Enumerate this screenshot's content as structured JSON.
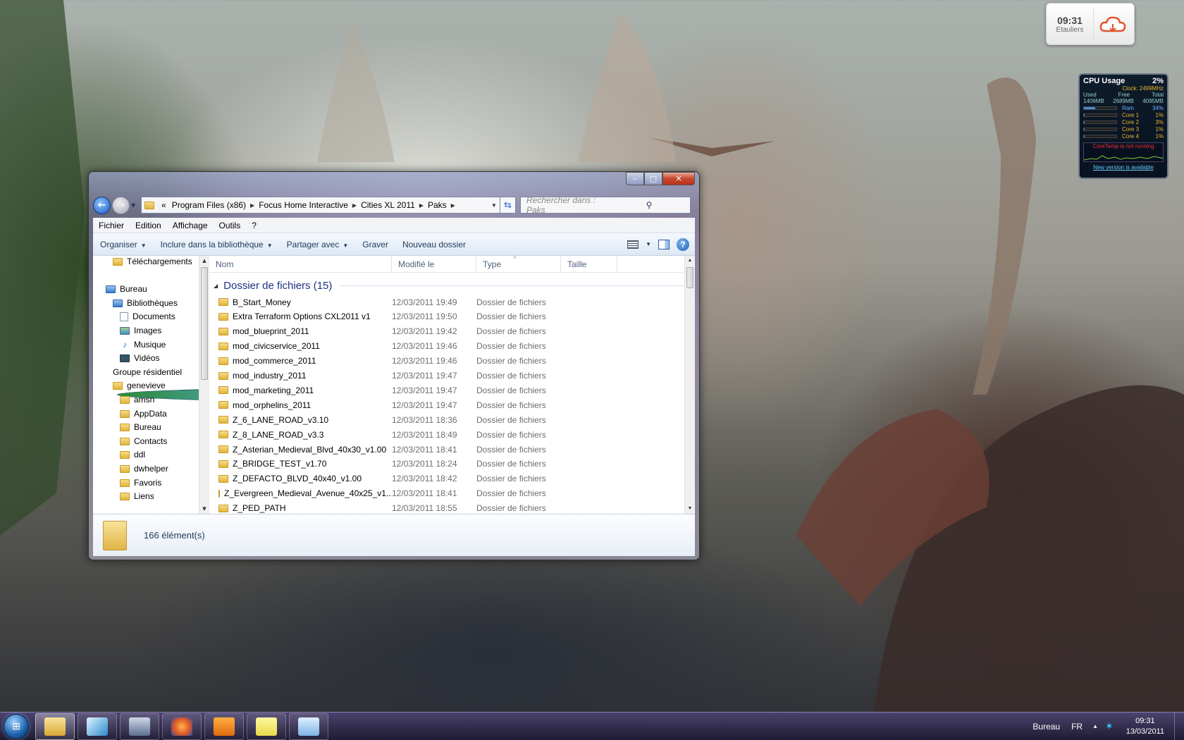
{
  "desktop": {
    "clock_gadget": {
      "time": "09:31",
      "city": "Etauliers"
    },
    "cpu_gadget": {
      "title": "CPU Usage",
      "total_percent": "2%",
      "clock": "Clock: 2499MHz",
      "mem_headers": [
        "Used",
        "Free",
        "Total"
      ],
      "mem_values": [
        "1406MB",
        "2689MB",
        "4095MB"
      ],
      "rows": [
        {
          "label": "Ram",
          "percent": "34%",
          "fill": 0.34
        },
        {
          "label": "Core 1",
          "percent": "1%",
          "fill": 0.01
        },
        {
          "label": "Core 2",
          "percent": "3%",
          "fill": 0.03
        },
        {
          "label": "Core 3",
          "percent": "1%",
          "fill": 0.01
        },
        {
          "label": "Core 4",
          "percent": "1%",
          "fill": 0.01
        }
      ],
      "warning": "CoreTemp is not running",
      "link": "New version is available"
    }
  },
  "window": {
    "caption": {
      "minimize": "–",
      "maximize": "□",
      "close": "✕"
    },
    "address": {
      "overflow": "«",
      "segments": [
        "Program Files (x86)",
        "Focus Home Interactive",
        "Cities XL 2011",
        "Paks"
      ]
    },
    "search_placeholder": "Rechercher dans : Paks",
    "menu": [
      "Fichier",
      "Edition",
      "Affichage",
      "Outils",
      "?"
    ],
    "commands": {
      "organize": "Organiser",
      "library": "Inclure dans la bibliothèque",
      "share": "Partager avec",
      "burn": "Graver",
      "new_folder": "Nouveau dossier"
    },
    "tree": [
      {
        "label": "Téléchargements",
        "icon": "folder",
        "indent": 1
      },
      {
        "label": "Bureau",
        "icon": "desktop",
        "indent": 0
      },
      {
        "label": "Bibliothèques",
        "icon": "libraries",
        "indent": 1
      },
      {
        "label": "Documents",
        "icon": "documents",
        "indent": 2
      },
      {
        "label": "Images",
        "icon": "images",
        "indent": 2
      },
      {
        "label": "Musique",
        "icon": "music",
        "indent": 2
      },
      {
        "label": "Vidéos",
        "icon": "videos",
        "indent": 2
      },
      {
        "label": "Groupe résidentiel",
        "icon": "homegroup",
        "indent": 1
      },
      {
        "label": "genevieve",
        "icon": "user-folder",
        "indent": 1
      },
      {
        "label": "amsn",
        "icon": "folder",
        "indent": 2
      },
      {
        "label": "AppData",
        "icon": "folder",
        "indent": 2
      },
      {
        "label": "Bureau",
        "icon": "folder",
        "indent": 2
      },
      {
        "label": "Contacts",
        "icon": "folder",
        "indent": 2
      },
      {
        "label": "ddl",
        "icon": "folder",
        "indent": 2
      },
      {
        "label": "dwhelper",
        "icon": "folder",
        "indent": 2
      },
      {
        "label": "Favoris",
        "icon": "folder",
        "indent": 2
      },
      {
        "label": "Liens",
        "icon": "folder",
        "indent": 2
      }
    ],
    "columns": [
      "Nom",
      "Modifié le",
      "Type",
      "Taille"
    ],
    "group_label": "Dossier de fichiers (15)",
    "files": [
      {
        "name": "B_Start_Money",
        "date": "12/03/2011 19:49",
        "type": "Dossier de fichiers"
      },
      {
        "name": "Extra Terraform Options CXL2011 v1",
        "date": "12/03/2011 19:50",
        "type": "Dossier de fichiers"
      },
      {
        "name": "mod_blueprint_2011",
        "date": "12/03/2011 19:42",
        "type": "Dossier de fichiers"
      },
      {
        "name": "mod_civicservice_2011",
        "date": "12/03/2011 19:46",
        "type": "Dossier de fichiers"
      },
      {
        "name": "mod_commerce_2011",
        "date": "12/03/2011 19:46",
        "type": "Dossier de fichiers"
      },
      {
        "name": "mod_industry_2011",
        "date": "12/03/2011 19:47",
        "type": "Dossier de fichiers"
      },
      {
        "name": "mod_marketing_2011",
        "date": "12/03/2011 19:47",
        "type": "Dossier de fichiers"
      },
      {
        "name": "mod_orphelins_2011",
        "date": "12/03/2011 19:47",
        "type": "Dossier de fichiers"
      },
      {
        "name": "Z_6_LANE_ROAD_v3.10",
        "date": "12/03/2011 18:36",
        "type": "Dossier de fichiers"
      },
      {
        "name": "Z_8_LANE_ROAD_v3.3",
        "date": "12/03/2011 18:49",
        "type": "Dossier de fichiers"
      },
      {
        "name": "Z_Asterian_Medieval_Blvd_40x30_v1.00",
        "date": "12/03/2011 18:41",
        "type": "Dossier de fichiers"
      },
      {
        "name": "Z_BRIDGE_TEST_v1.70",
        "date": "12/03/2011 18:24",
        "type": "Dossier de fichiers"
      },
      {
        "name": "Z_DEFACTO_BLVD_40x40_v1.00",
        "date": "12/03/2011 18:42",
        "type": "Dossier de fichiers"
      },
      {
        "name": "Z_Evergreen_Medieval_Avenue_40x25_v1....",
        "date": "12/03/2011 18:41",
        "type": "Dossier de fichiers"
      },
      {
        "name": "Z_PED_PATH",
        "date": "12/03/2011 18:55",
        "type": "Dossier de fichiers"
      }
    ],
    "status": "166 élément(s)"
  },
  "taskbar": {
    "start_icon": "windows-orb",
    "buttons": [
      {
        "name": "explorer",
        "icon": "folder-icon",
        "active": true
      },
      {
        "name": "feather-app",
        "icon": "feather-icon",
        "active": false
      },
      {
        "name": "network-app",
        "icon": "network-icon",
        "active": false
      },
      {
        "name": "firefox",
        "icon": "firefox-icon",
        "active": false
      },
      {
        "name": "media-player",
        "icon": "play-icon",
        "active": false
      },
      {
        "name": "sticky-notes",
        "icon": "notes-icon",
        "active": false
      },
      {
        "name": "snipping-tool",
        "icon": "snip-icon",
        "active": false
      }
    ],
    "tray": {
      "toolbar_label": "Bureau",
      "language": "FR",
      "time": "09:31",
      "date": "13/03/2011"
    }
  }
}
